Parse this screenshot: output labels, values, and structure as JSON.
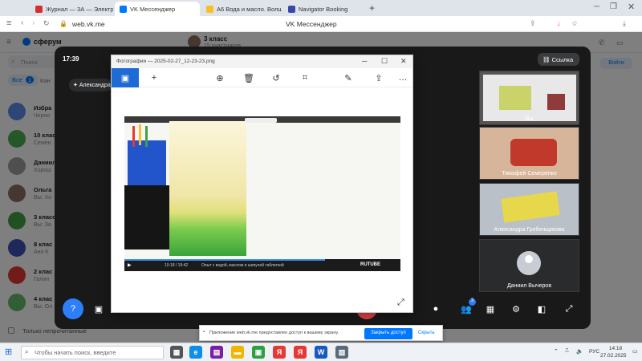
{
  "browser": {
    "tabs": [
      {
        "label": "Журнал — 3А — Электрон"
      },
      {
        "label": "VK Мессенджер"
      },
      {
        "label": "А6 Вода и масло. Волше"
      },
      {
        "label": "Navigator Booking"
      }
    ],
    "new_tab": "+",
    "address": "web.vk.me",
    "page_title": "VK Мессенджер"
  },
  "vk": {
    "logo": "сферум",
    "search_placeholder": "Поиск",
    "filter_all": "Все",
    "filter_all_badge": "1",
    "filter_other": "Кан",
    "chats": [
      {
        "name": "Избра",
        "preview": "Черно",
        "color": "#5b8def"
      },
      {
        "name": "10 клас",
        "preview": "Семен",
        "color": "#4caf50"
      },
      {
        "name": "Даниил",
        "preview": "Хорош",
        "color": "#9e9e9e"
      },
      {
        "name": "Ольга",
        "preview": "Вы: Хо",
        "color": "#8d6e63"
      },
      {
        "name": "3 класс",
        "preview": "Вы: За",
        "color": "#43a047"
      },
      {
        "name": "8 клас",
        "preview": "Аня К",
        "color": "#3f51b5"
      },
      {
        "name": "2 клас",
        "preview": "Галин",
        "color": "#e53935"
      },
      {
        "name": "4 клас",
        "preview": "Вы: Ол",
        "color": "#66bb6a"
      }
    ],
    "only_unread": "Только непрочитанные",
    "header_chat": "3 класс",
    "header_sub": "15 участников",
    "enter_button": "Войти"
  },
  "call": {
    "time": "17:39",
    "link_button": "Ссылка",
    "presenter": "Александра",
    "participants": [
      {
        "name": "Тимофей Семеренко"
      },
      {
        "name": "Александра Гребенщикова"
      },
      {
        "name": "Даниил Вычеров"
      }
    ],
    "tile_top_label": "Вы",
    "raise_badge": "3"
  },
  "photos": {
    "title": "Фотографии — 2025-02-27_12-23-23.png",
    "video_time": "10:18 / 19:42",
    "video_caption": "Опыт с водой, маслом и шипучей таблеткой",
    "video_brand": "RUTUBE"
  },
  "notification": {
    "text": "Приложение web.vk.me предоставлен доступ к вашему экрану.",
    "primary": "Закрыть доступ",
    "secondary": "Скрыть"
  },
  "taskbar": {
    "search_placeholder": "Чтобы начать поиск, введите",
    "lang": "РУС",
    "time": "14:18",
    "date": "27.02.2025"
  },
  "colors": {
    "accent": "#0077ff",
    "danger": "#e64646",
    "call_bg": "#19191a"
  }
}
